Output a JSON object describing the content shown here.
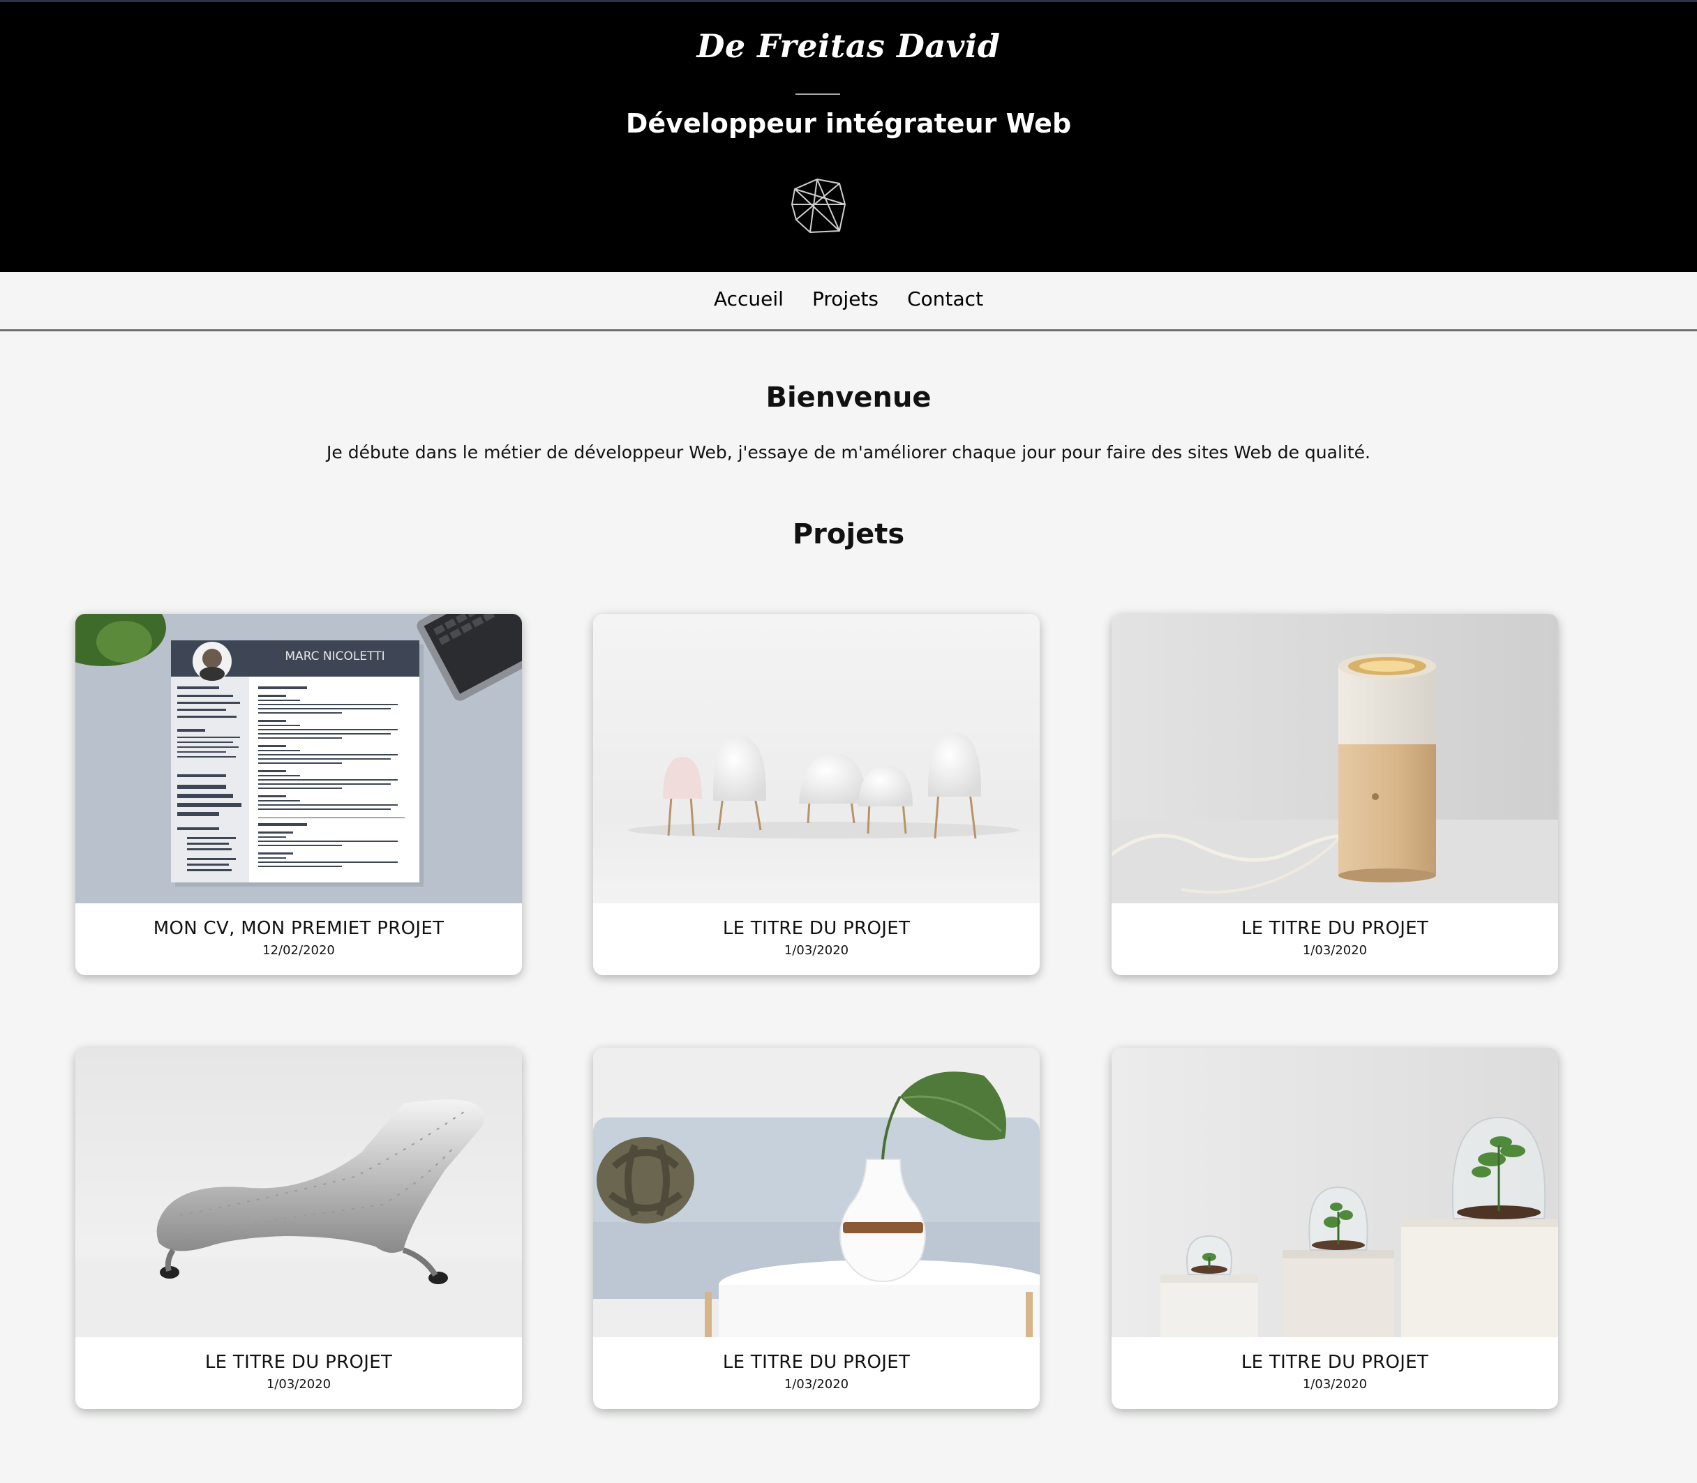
{
  "header": {
    "name": "De Freitas David",
    "subtitle": "Développeur intégrateur Web",
    "emblem_icon": "geometric-wireframe-icon"
  },
  "nav": {
    "items": [
      {
        "label": "Accueil"
      },
      {
        "label": "Projets"
      },
      {
        "label": "Contact"
      }
    ]
  },
  "welcome": {
    "title": "Bienvenue",
    "text": "Je débute dans le métier de développeur Web, j'essaye de m'améliorer chaque jour pour faire des sites Web de qualité."
  },
  "projects": {
    "title": "Projets",
    "cards": [
      {
        "title": "MON CV, MON PREMIET PROJET",
        "date": "12/02/2020",
        "image": "resume-mockup-image",
        "image_text": "MARC NICOLETTI"
      },
      {
        "title": "LE TITRE DU PROJET",
        "date": "1/03/2020",
        "image": "white-lamps-image"
      },
      {
        "title": "LE TITRE DU PROJET",
        "date": "1/03/2020",
        "image": "wood-lamp-image"
      },
      {
        "title": "LE TITRE DU PROJET",
        "date": "1/03/2020",
        "image": "metal-chaise-image"
      },
      {
        "title": "LE TITRE DU PROJET",
        "date": "1/03/2020",
        "image": "sofa-vase-image"
      },
      {
        "title": "LE TITRE DU PROJET",
        "date": "1/03/2020",
        "image": "terrarium-image"
      }
    ]
  },
  "colors": {
    "header_bg": "#000000",
    "page_bg": "#f4f5f4",
    "nav_border": "#6e6e6e",
    "card_bg": "#ffffff"
  }
}
